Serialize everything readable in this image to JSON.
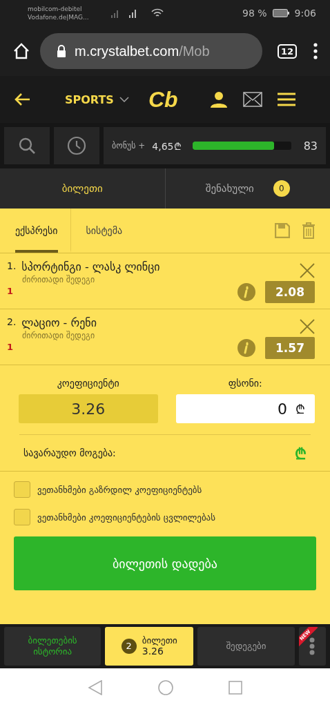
{
  "status_bar": {
    "carrier_lines": [
      "mobilcom-debitel",
      "Vodafone.de|MAG..."
    ],
    "battery": "98 %",
    "time": "9:06"
  },
  "browser": {
    "url_host": "m.crystalbet.com",
    "url_path": "/Mob",
    "tab_count": "12"
  },
  "header": {
    "section": "SPORTS",
    "logo": "Cb"
  },
  "bonus": {
    "label": "ბონუს +",
    "amount": "4,65₾",
    "level": 0.83,
    "value": "83"
  },
  "tabs": [
    {
      "label": "ბილეთი",
      "selected": true
    },
    {
      "label": "შენახული",
      "selected": false,
      "count": "0"
    }
  ],
  "bet_types": [
    {
      "label": "ექსპრესი",
      "selected": true
    },
    {
      "label": "სისტემა",
      "selected": false
    }
  ],
  "selections": [
    {
      "number": "1.",
      "event": "სპორტინგი - ლასკ ლინცი",
      "market": "ძირითადი შედეგი",
      "pick": "1",
      "odds": "2.08"
    },
    {
      "number": "2.",
      "event": "ლაციო - რენი",
      "market": "ძირითადი შედეგი",
      "pick": "1",
      "odds": "1.57"
    }
  ],
  "totals": {
    "odds_label": "კოეფიციენტი",
    "odds": "3.26",
    "stake_label": "ფსონი:",
    "stake": "0",
    "currency": "₾",
    "win_label": "სავარაუდო მოგება:",
    "win_currency": "₾"
  },
  "options": [
    {
      "label": "ვეთანხმები გაზრდილ კოეფიციენტებს",
      "checked": false
    },
    {
      "label": "ვეთანხმები კოეფიციენტების ცვლილებას",
      "checked": false
    }
  ],
  "place_button": "ბილეთის დადება",
  "bottom_nav": [
    {
      "kind": "text",
      "label": "ბილეთების ისტორია",
      "selected": false
    },
    {
      "kind": "ticket",
      "count": "2",
      "label": "ბილეთი",
      "odds": "3.26",
      "selected": true
    },
    {
      "kind": "text",
      "label": "შედეგები",
      "selected": false
    },
    {
      "kind": "more",
      "badge": "NEW",
      "selected": false
    }
  ]
}
